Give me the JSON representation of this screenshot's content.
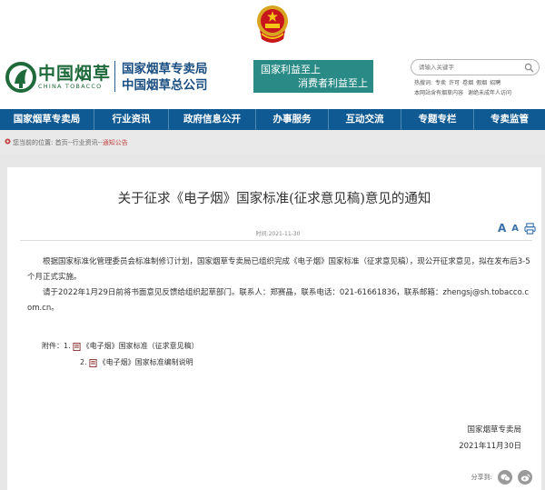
{
  "header": {
    "logo_cn": "中国烟草",
    "logo_en": "CHINA TOBACCO",
    "agency_line1": "国家烟草专卖局",
    "agency_line2": "中国烟草总公司",
    "slogan_line1": "国家利益至上",
    "slogan_line2": "消费者利益至上",
    "search_placeholder": "请输入关键字",
    "hotwords_label": "热搜词:",
    "hotwords": [
      "专卖",
      "许可",
      "卷烟",
      "假烟",
      "招聘"
    ],
    "sublinks": [
      "本网站含有烟草内容",
      "谢绝未成年人访问"
    ]
  },
  "nav": {
    "items": [
      "国家烟草专卖局",
      "行业资讯",
      "政府信息公开",
      "办事服务",
      "互动交流",
      "专题专栏",
      "专卖监管"
    ]
  },
  "breadcrumb": {
    "label": "您当前的位置:",
    "home": "首页",
    "sep": "--",
    "section": "行业资讯",
    "current": "通知公告"
  },
  "article": {
    "title": "关于征求《电子烟》国家标准(征求意见稿)意见的通知",
    "time_label": "时间:",
    "time": "2021-11-30",
    "font_large": "A",
    "font_small": "A",
    "para1": "根据国家标准化管理委员会标准制修订计划，国家烟草专卖局已组织完成《电子烟》国家标准（征求意见稿），现公开征求意见，拟在发布后3-5个月正式实施。",
    "para2": "请于2022年1月29日前将书面意见反馈给组织起草部门。联系人：郑赛晶，联系电话：021-61661836，联系邮箱：zhengsj@sh.tobacco.com.cn。",
    "attach_label": "附件：",
    "attachments": [
      {
        "num": "1.",
        "title": "《电子烟》国家标准（征求意见稿）"
      },
      {
        "num": "2.",
        "title": "《电子烟》国家标准编制说明"
      }
    ],
    "sign_org": "国家烟草专卖局",
    "sign_date": "2021年11月30日",
    "share_label": "分享到:"
  },
  "colors": {
    "nav_bg": "#0f5a93",
    "brand_green": "#1f6a3a",
    "slogan_bg": "#2a8b86",
    "agency_blue": "#1b4f82",
    "breadcrumb_current": "#c34646"
  },
  "icons": [
    "national-emblem-icon",
    "china-tobacco-logo-icon",
    "search-icon",
    "location-icon",
    "print-icon",
    "document-icon",
    "wechat-icon",
    "weibo-icon"
  ]
}
